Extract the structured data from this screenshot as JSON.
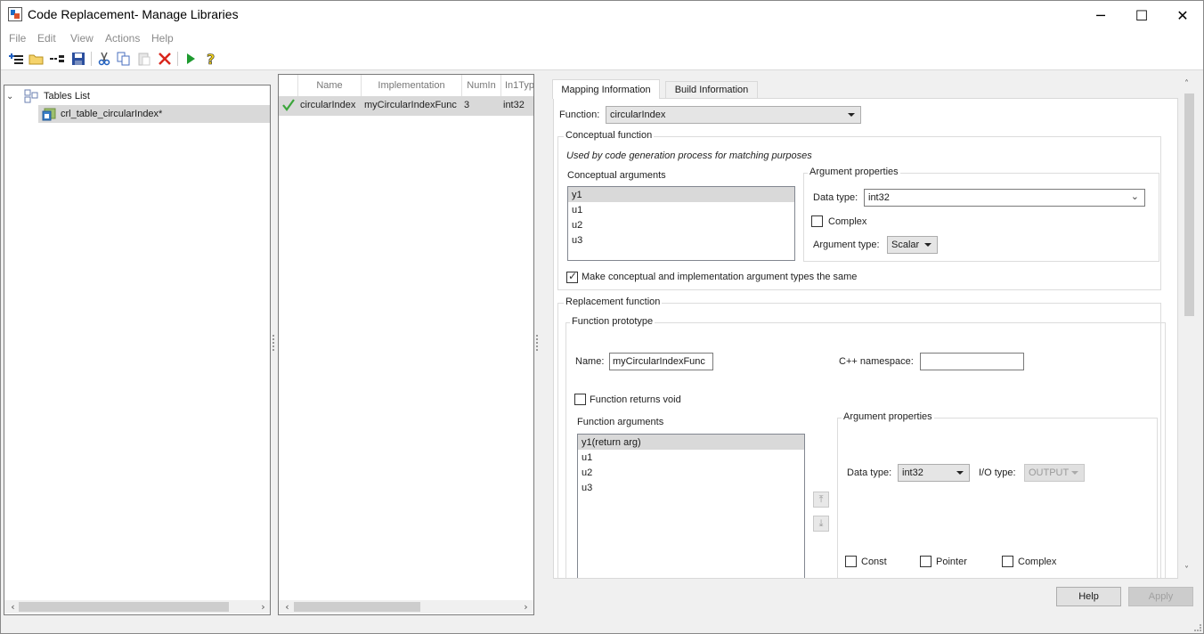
{
  "window": {
    "title": "Code Replacement- Manage Libraries",
    "controls": {
      "minimize": "─",
      "maximize": "☐",
      "close": "✕"
    }
  },
  "menu": [
    "File",
    "Edit",
    "View",
    "Actions",
    "Help"
  ],
  "toolbar": [
    {
      "name": "new-table-icon"
    },
    {
      "name": "open-folder-icon"
    },
    {
      "name": "new-entry-icon"
    },
    {
      "name": "save-icon"
    },
    {
      "name": "cut-icon"
    },
    {
      "name": "copy-icon"
    },
    {
      "name": "paste-icon"
    },
    {
      "name": "delete-icon"
    },
    {
      "name": "run-icon"
    },
    {
      "name": "help-icon"
    }
  ],
  "tree": {
    "root": "Tables List",
    "items": [
      "crl_table_circularIndex*"
    ]
  },
  "entries_table": {
    "columns": [
      "Name",
      "Implementation",
      "NumIn",
      "In1Typ"
    ],
    "rows": [
      {
        "valid": true,
        "name": "circularIndex",
        "implementation": "myCircularIndexFunc",
        "numin": "3",
        "in1type": "int32"
      }
    ]
  },
  "tabs": [
    {
      "label": "Mapping Information",
      "active": true
    },
    {
      "label": "Build Information",
      "active": false
    }
  ],
  "mapping": {
    "function_label": "Function:",
    "function_value": "circularIndex",
    "conceptual": {
      "title": "Conceptual function",
      "description": "Used by code generation process for matching purposes",
      "args_label": "Conceptual arguments",
      "args": [
        "y1",
        "u1",
        "u2",
        "u3"
      ],
      "selected_arg": 0,
      "props": {
        "title": "Argument properties",
        "data_type_label": "Data type:",
        "data_type_value": "int32",
        "complex_label": "Complex",
        "complex_checked": false,
        "arg_type_label": "Argument type:",
        "arg_type_value": "Scalar"
      },
      "same_types_label": "Make conceptual and implementation argument types the same",
      "same_types_checked": true
    },
    "replacement": {
      "title": "Replacement function",
      "prototype_title": "Function prototype",
      "name_label": "Name:",
      "name_value": "myCircularIndexFunc",
      "namespace_label": "C++ namespace:",
      "namespace_value": "",
      "returns_void_label": "Function returns void",
      "returns_void_checked": false,
      "args_label": "Function arguments",
      "args": [
        "y1(return arg)",
        "u1",
        "u2",
        "u3"
      ],
      "selected_arg": 0,
      "props": {
        "title": "Argument properties",
        "data_type_label": "Data type:",
        "data_type_value": "int32",
        "io_type_label": "I/O type:",
        "io_type_value": "OUTPUT",
        "const_label": "Const",
        "pointer_label": "Pointer",
        "complex_label": "Complex"
      }
    }
  },
  "buttons": {
    "help": "Help",
    "apply": "Apply"
  }
}
